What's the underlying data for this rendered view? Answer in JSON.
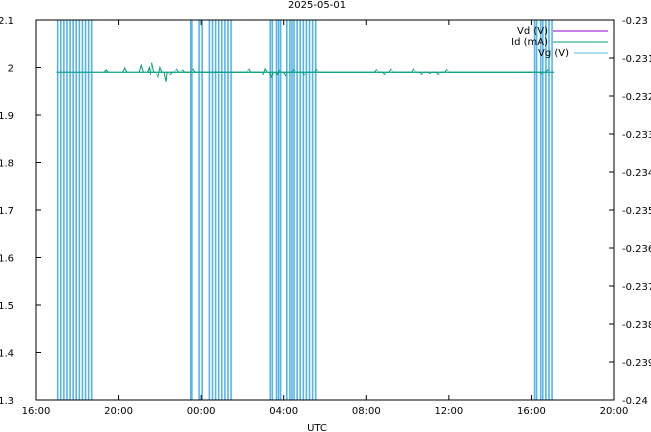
{
  "chart_data": {
    "type": "line",
    "title": "2025-05-01",
    "xlabel": "UTC",
    "xlim_hours": [
      16,
      44
    ],
    "x_ticks": [
      "16:00",
      "20:00",
      "00:00",
      "04:00",
      "08:00",
      "12:00",
      "16:00",
      "20:00"
    ],
    "y_left": {
      "ylim": [
        1.3,
        2.1
      ],
      "ticks": [
        "1.3",
        "1.4",
        "1.5",
        "1.6",
        "1.7",
        "1.8",
        "1.9",
        "2",
        "2.1"
      ]
    },
    "y_right": {
      "ylim": [
        -0.24,
        -0.23
      ],
      "ticks": [
        "-0.24",
        "-0.239",
        "-0.238",
        "-0.237",
        "-0.236",
        "-0.235",
        "-0.234",
        "-0.233",
        "-0.232",
        "-0.231",
        "-0.23"
      ]
    },
    "grid": false,
    "legend_position": "top-right",
    "series": [
      {
        "name": "Vd (V)",
        "color": "#9400d3",
        "axis": "left",
        "baseline": 1.99,
        "points": []
      },
      {
        "name": "Id (mA)",
        "color": "#009e73",
        "axis": "left",
        "baseline": 1.99,
        "x_range": [
          17.0,
          41.1
        ],
        "points": [
          [
            19.3,
            1.99
          ],
          [
            19.4,
            1.995
          ],
          [
            19.5,
            1.99
          ],
          [
            20.2,
            1.99
          ],
          [
            20.3,
            1.999
          ],
          [
            20.4,
            1.99
          ],
          [
            21.0,
            1.99
          ],
          [
            21.1,
            2.005
          ],
          [
            21.2,
            1.99
          ],
          [
            21.4,
            1.99
          ],
          [
            21.5,
            2.0
          ],
          [
            21.55,
            1.985
          ],
          [
            21.6,
            2.01
          ],
          [
            21.7,
            1.99
          ],
          [
            21.8,
            1.99
          ],
          [
            21.9,
            1.98
          ],
          [
            22.0,
            2.0
          ],
          [
            22.1,
            1.99
          ],
          [
            22.2,
            1.99
          ],
          [
            22.3,
            1.97
          ],
          [
            22.35,
            1.99
          ],
          [
            22.5,
            1.985
          ],
          [
            22.6,
            1.99
          ],
          [
            22.7,
            1.99
          ],
          [
            22.8,
            1.997
          ],
          [
            22.9,
            1.99
          ],
          [
            23.0,
            1.99
          ],
          [
            23.1,
            1.995
          ],
          [
            23.2,
            1.99
          ],
          [
            23.5,
            1.99
          ],
          [
            23.6,
            1.997
          ],
          [
            23.7,
            1.99
          ],
          [
            26.2,
            1.99
          ],
          [
            26.3,
            1.997
          ],
          [
            26.4,
            1.99
          ],
          [
            26.9,
            1.99
          ],
          [
            27.0,
            1.985
          ],
          [
            27.1,
            1.997
          ],
          [
            27.2,
            1.99
          ],
          [
            27.3,
            1.99
          ],
          [
            27.4,
            1.98
          ],
          [
            27.5,
            1.99
          ],
          [
            27.6,
            1.99
          ],
          [
            27.7,
            1.985
          ],
          [
            27.8,
            1.995
          ],
          [
            27.9,
            1.99
          ],
          [
            28.0,
            1.99
          ],
          [
            28.1,
            1.982
          ],
          [
            28.2,
            1.99
          ],
          [
            28.4,
            1.99
          ],
          [
            28.5,
            1.996
          ],
          [
            28.6,
            1.99
          ],
          [
            28.9,
            1.99
          ],
          [
            29.0,
            1.984
          ],
          [
            29.1,
            1.99
          ],
          [
            29.5,
            1.99
          ],
          [
            29.6,
            1.996
          ],
          [
            29.7,
            1.99
          ],
          [
            32.4,
            1.99
          ],
          [
            32.5,
            1.996
          ],
          [
            32.6,
            1.99
          ],
          [
            32.8,
            1.99
          ],
          [
            32.9,
            1.985
          ],
          [
            33.0,
            1.99
          ],
          [
            33.1,
            1.99
          ],
          [
            33.2,
            1.997
          ],
          [
            33.3,
            1.99
          ],
          [
            34.2,
            1.99
          ],
          [
            34.3,
            1.997
          ],
          [
            34.4,
            1.99
          ],
          [
            34.6,
            1.99
          ],
          [
            34.7,
            1.985
          ],
          [
            34.8,
            1.99
          ],
          [
            35.0,
            1.99
          ],
          [
            35.1,
            1.987
          ],
          [
            35.2,
            1.99
          ],
          [
            35.4,
            1.99
          ],
          [
            35.5,
            1.985
          ],
          [
            35.6,
            1.99
          ],
          [
            35.8,
            1.99
          ],
          [
            35.9,
            1.996
          ],
          [
            36.0,
            1.99
          ],
          [
            40.4,
            1.99
          ],
          [
            40.5,
            1.986
          ],
          [
            40.6,
            1.99
          ],
          [
            40.7,
            1.99
          ],
          [
            40.8,
            1.996
          ],
          [
            40.9,
            1.99
          ]
        ]
      },
      {
        "name": "Vg (V)",
        "color": "#56b4e9",
        "axis": "left",
        "baseline": 1.99,
        "x_range": [
          17.0,
          41.1
        ],
        "drop_value": 1.3,
        "spike_value": 2.1,
        "drop_times": [
          17.05,
          17.2,
          17.35,
          17.5,
          17.65,
          17.8,
          17.95,
          18.1,
          18.25,
          18.4,
          18.55,
          18.7,
          23.5,
          23.55,
          23.9,
          24.05,
          24.4,
          24.55,
          24.7,
          24.85,
          25.0,
          25.15,
          25.3,
          25.45,
          27.35,
          27.45,
          27.65,
          27.75,
          27.85,
          28.15,
          28.3,
          28.4,
          28.5,
          28.65,
          28.8,
          28.95,
          29.1,
          29.25,
          29.4,
          29.55,
          40.15,
          40.25,
          40.45,
          40.55,
          40.7,
          40.85,
          41.0
        ]
      }
    ]
  }
}
